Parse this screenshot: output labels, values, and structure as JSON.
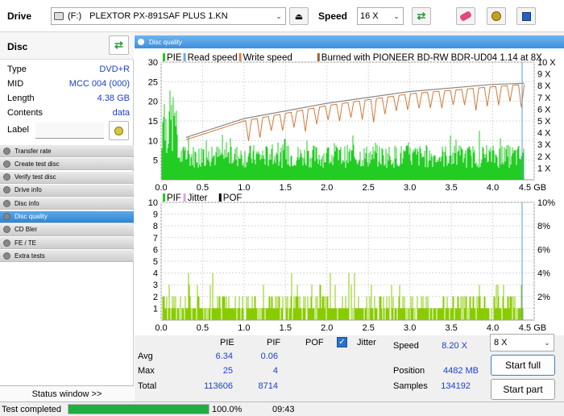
{
  "toolbar": {
    "drive_label": "Drive",
    "drive_letter": "(F:)",
    "drive_name": "PLEXTOR PX-891SAF PLUS 1.KN",
    "speed_label": "Speed",
    "speed_value": "16 X"
  },
  "disc": {
    "title": "Disc",
    "rows": [
      {
        "key": "Type",
        "value": "DVD+R"
      },
      {
        "key": "MID",
        "value": "MCC 004 (000)"
      },
      {
        "key": "Length",
        "value": "4.38 GB"
      },
      {
        "key": "Contents",
        "value": "data"
      }
    ],
    "label_key": "Label",
    "label_value": ""
  },
  "nav": [
    {
      "label": "Transfer rate",
      "active": false
    },
    {
      "label": "Create test disc",
      "active": false
    },
    {
      "label": "Verify test disc",
      "active": false
    },
    {
      "label": "Drive info",
      "active": false
    },
    {
      "label": "Disc info",
      "active": false
    },
    {
      "label": "Disc quality",
      "active": true
    },
    {
      "label": "CD Bler",
      "active": false
    },
    {
      "label": "FE / TE",
      "active": false
    },
    {
      "label": "Extra tests",
      "active": false
    }
  ],
  "status_window_label": "Status window >>",
  "panel_title": "Disc quality",
  "chart_data": [
    {
      "type": "bar",
      "legend": [
        "PIE",
        "Read speed",
        "Write speed",
        "Burned with PIONEER BD-RW   BDR-UD04 1.14 at 8X"
      ],
      "legend_colors": [
        "#22cc22",
        "#66aaee",
        "#e08040",
        "#a06030"
      ],
      "x_ticks": [
        "0.0",
        "0.5",
        "1.0",
        "1.5",
        "2.0",
        "2.5",
        "3.0",
        "3.5",
        "4.0",
        "4.5 GB"
      ],
      "xlim": [
        0,
        4.5
      ],
      "y_ticks_left": [
        "5",
        "10",
        "15",
        "20",
        "25",
        "30"
      ],
      "ylim_left": [
        0,
        30
      ],
      "y_ticks_right": [
        "1 X",
        "2 X",
        "3 X",
        "4 X",
        "5 X",
        "6 X",
        "7 X",
        "8 X",
        "9 X",
        "10 X"
      ],
      "ylim_right": [
        0,
        10
      ],
      "series": [
        {
          "name": "PIE",
          "color": "#22cc22",
          "avg": 6.34,
          "max": 25,
          "total": 113606
        },
        {
          "name": "Read speed",
          "color": "#888888",
          "points": [
            [
              0.3,
              3.6
            ],
            [
              1.0,
              5.2
            ],
            [
              2.0,
              6.5
            ],
            [
              3.0,
              7.5
            ],
            [
              4.0,
              8.1
            ],
            [
              4.38,
              8.2
            ]
          ]
        },
        {
          "name": "Write speed",
          "color": "#e08040",
          "points": [
            [
              0.3,
              3.4
            ],
            [
              1.0,
              5.0
            ],
            [
              2.0,
              6.3
            ],
            [
              3.0,
              7.3
            ],
            [
              4.0,
              7.9
            ],
            [
              4.38,
              8.1
            ]
          ]
        }
      ]
    },
    {
      "type": "bar",
      "legend": [
        "PIF",
        "Jitter",
        "POF"
      ],
      "legend_colors": [
        "#22cc22",
        "#e0a0e0",
        "#000000"
      ],
      "x_ticks": [
        "0.0",
        "0.5",
        "1.0",
        "1.5",
        "2.0",
        "2.5",
        "3.0",
        "3.5",
        "4.0",
        "4.5 GB"
      ],
      "xlim": [
        0,
        4.5
      ],
      "y_ticks_left": [
        "1",
        "2",
        "3",
        "4",
        "5",
        "6",
        "7",
        "8",
        "9",
        "10"
      ],
      "ylim_left": [
        0,
        10
      ],
      "y_ticks_right": [
        "2%",
        "4%",
        "6%",
        "8%",
        "10%"
      ],
      "series": [
        {
          "name": "PIF",
          "color": "#88cc00",
          "avg": 0.06,
          "max": 4,
          "total": 8714
        }
      ]
    }
  ],
  "stats": {
    "headers": [
      "PIE",
      "PIF",
      "POF"
    ],
    "jitter_label": "Jitter",
    "jitter_checked": true,
    "rows": [
      {
        "label": "Avg",
        "pie": "6.34",
        "pif": "0.06"
      },
      {
        "label": "Max",
        "pie": "25",
        "pif": "4"
      },
      {
        "label": "Total",
        "pie": "113606",
        "pif": "8714"
      }
    ],
    "speed_label": "Speed",
    "speed_value": "8.20 X",
    "speed_select": "8 X",
    "position_label": "Position",
    "position_value": "4482 MB",
    "samples_label": "Samples",
    "samples_value": "134192",
    "start_full": "Start full",
    "start_part": "Start part"
  },
  "status": {
    "text": "Test completed",
    "progress": 100,
    "percent": "100.0%",
    "time": "09:43"
  }
}
